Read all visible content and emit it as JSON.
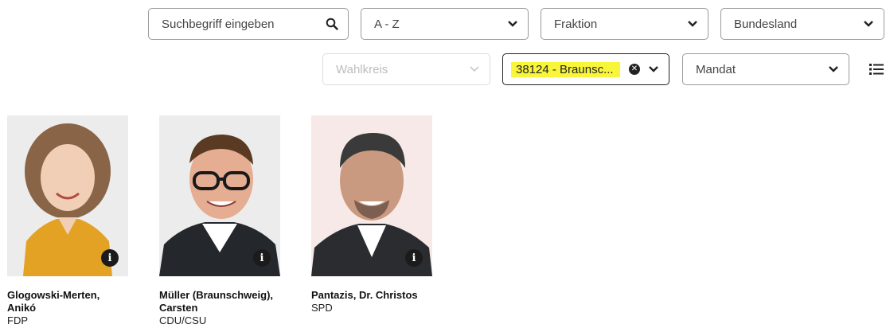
{
  "filters": {
    "search": {
      "placeholder": "Suchbegriff eingeben",
      "icon": "search-icon"
    },
    "sort": {
      "value": "A - Z"
    },
    "fraktion": {
      "value": "Fraktion"
    },
    "bundesland": {
      "value": "Bundesland"
    },
    "wahlkreis": {
      "value": "Wahlkreis"
    },
    "ort": {
      "value": "38124 - Braunsc..."
    },
    "mandat": {
      "value": "Mandat"
    }
  },
  "view_toggle": {
    "icon": "list-view-icon"
  },
  "members": [
    {
      "name_line1": "Glogowski-Merten,",
      "name_line2": "Anikó",
      "party": "FDP",
      "info": "i"
    },
    {
      "name_line1": "Müller (Braunschweig),",
      "name_line2": "Carsten",
      "party": "CDU/CSU",
      "info": "i"
    },
    {
      "name_line1": "Pantazis, Dr. Christos",
      "name_line2": "",
      "party": "SPD",
      "info": "i"
    }
  ],
  "colors": {
    "highlight": "#f8f53a",
    "text": "#222222",
    "border": "#9a9a9a"
  }
}
